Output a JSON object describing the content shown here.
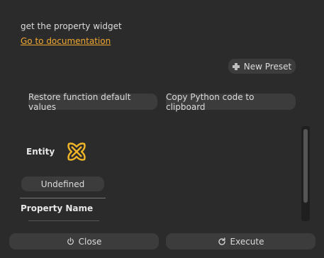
{
  "header": {
    "description": "get the property widget",
    "doc_link": "Go to documentation"
  },
  "toolbar": {
    "new_preset_label": "New Preset",
    "restore_label": "Restore function default values",
    "copy_label": "Copy Python code to clipboard"
  },
  "params": {
    "entity_label": "Entity",
    "entity_icon": "entity-knot-icon",
    "entity_value": "Undefined",
    "property_name_label": "Property Name"
  },
  "footer": {
    "close_label": "Close",
    "close_icon": "power-icon",
    "execute_label": "Execute",
    "execute_icon": "refresh-icon"
  },
  "colors": {
    "background": "#2b2b2b",
    "button": "#3c3c3c",
    "link": "#f0a830",
    "entity_icon": "#f0b429"
  }
}
